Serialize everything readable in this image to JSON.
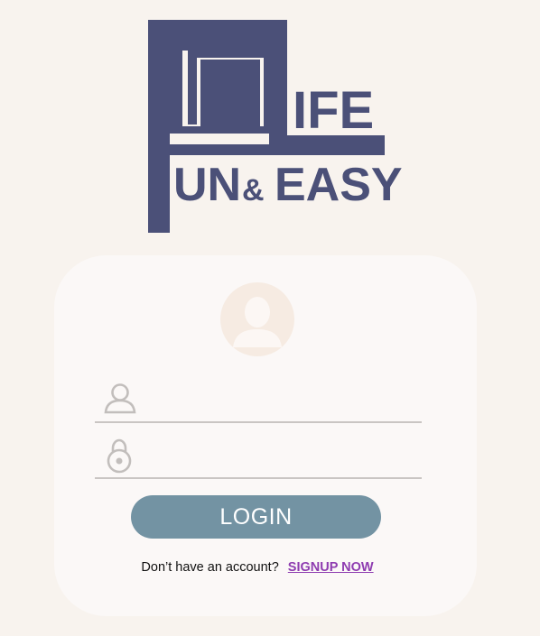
{
  "logo": {
    "letter_f": "F",
    "word_ife": "IFE",
    "word_un": "UN",
    "ampersand": "&",
    "word_easy": "EASY",
    "brand_color": "#4b5078"
  },
  "login_card": {
    "avatar_icon": "user-silhouette-icon",
    "username_field": {
      "icon": "user-outline-icon",
      "value": "",
      "placeholder": ""
    },
    "password_field": {
      "icon": "lock-outline-icon",
      "value": "",
      "placeholder": ""
    },
    "login_label": "LOGIN",
    "signup_prompt": "Don’t have an account?",
    "signup_label": "SIGNUP NOW"
  },
  "colors": {
    "page_background": "#f8f3ee",
    "card_background": "#fbf8f7",
    "button": "#7393a3",
    "link": "#8e3cb0",
    "avatar": "#f6ebe2"
  }
}
